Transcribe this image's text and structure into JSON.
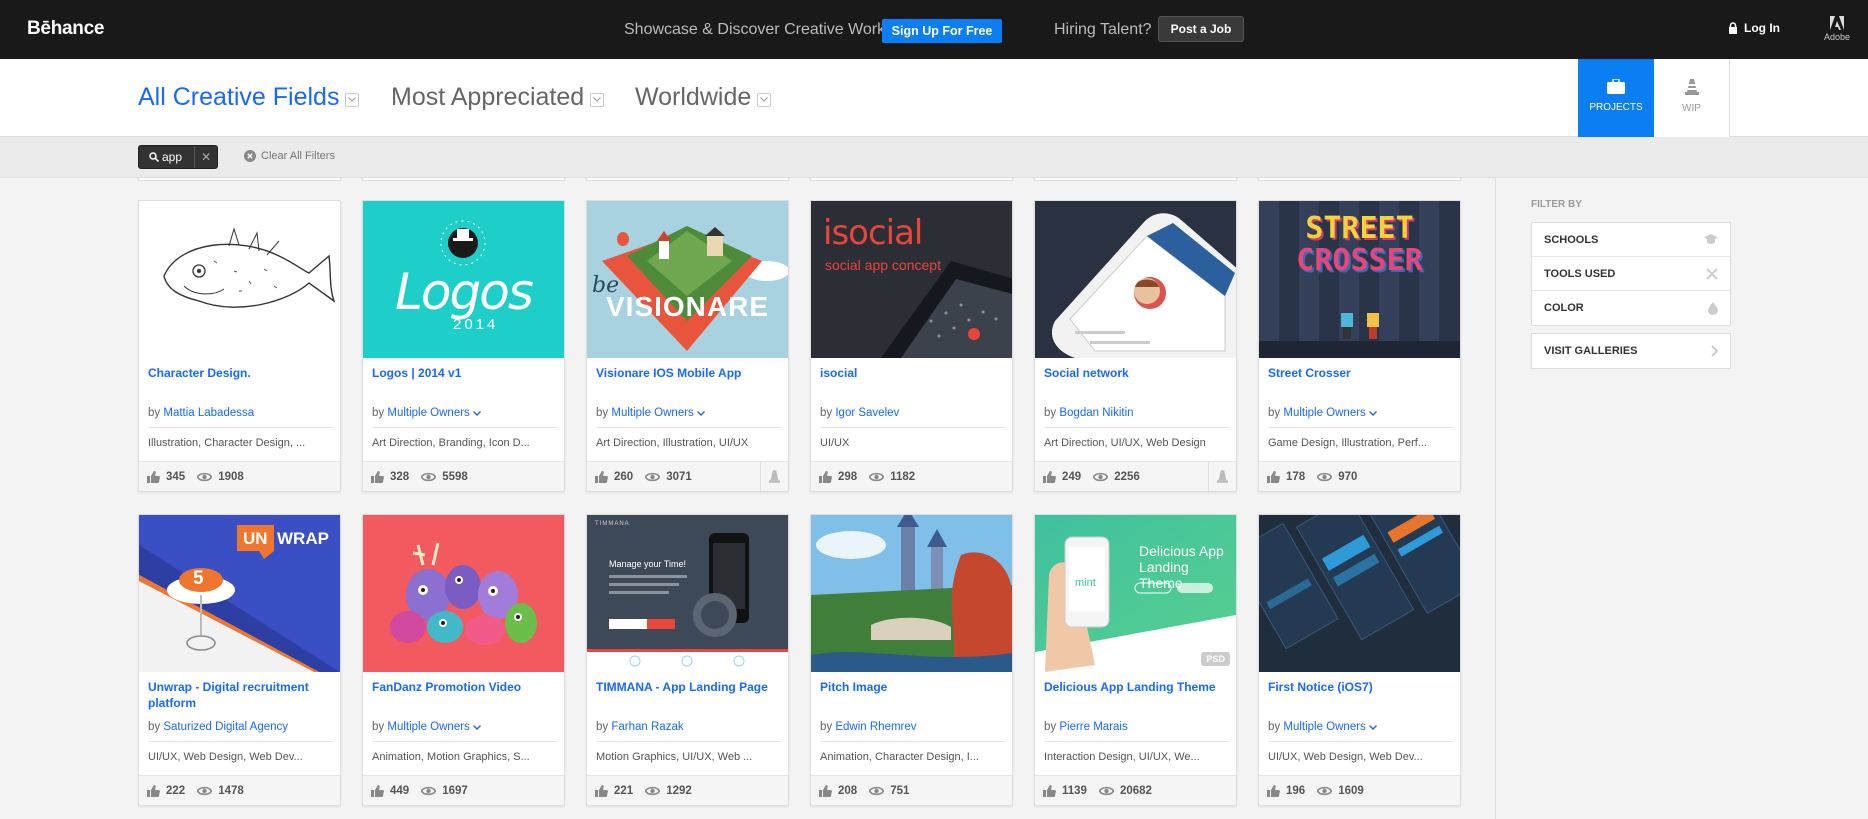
{
  "topbar": {
    "logo": "Bēhance",
    "tagline": "Showcase & Discover Creative Work",
    "signup_label": "Sign Up For Free",
    "hiring_label": "Hiring Talent?",
    "postjob_label": "Post a Job",
    "login_label": "Log In",
    "adobe_label": "Adobe"
  },
  "filters": {
    "field": "All Creative Fields",
    "sort": "Most Appreciated",
    "location": "Worldwide"
  },
  "tabs": {
    "projects": "PROJECTS",
    "wip": "WIP"
  },
  "search": {
    "term": "app",
    "clear_label": "Clear All Filters"
  },
  "sidebar": {
    "heading": "FILTER BY",
    "items": [
      {
        "label": "SCHOOLS",
        "icon": "graduation-cap-icon"
      },
      {
        "label": "TOOLS USED",
        "icon": "tools-icon"
      },
      {
        "label": "COLOR",
        "icon": "drop-icon"
      }
    ],
    "galleries_label": "VISIT GALLERIES"
  },
  "projects": [
    {
      "title": "Character Design.",
      "by": "by",
      "owner": "Mattia Labadessa",
      "multi": false,
      "fields": "Illustration, Character Design, ...",
      "likes": "345",
      "views": "1908",
      "thumb": "fish-sketch"
    },
    {
      "title": "Logos | 2014 v1",
      "by": "by",
      "owner": "Multiple Owners",
      "multi": true,
      "fields": "Art Direction, Branding, Icon D...",
      "likes": "328",
      "views": "5598",
      "thumb_text": "Logos",
      "thumb_sub": "2014"
    },
    {
      "title": "Visionare IOS Mobile App",
      "by": "by",
      "owner": "Multiple Owners",
      "multi": true,
      "fields": "Art Direction, Illustration, UI/UX",
      "likes": "260",
      "views": "3071",
      "wip": true,
      "thumb_text": "VISIONARE",
      "thumb_sub": "be"
    },
    {
      "title": "isocial",
      "by": "by",
      "owner": "Igor Savelev",
      "multi": false,
      "fields": "UI/UX",
      "likes": "298",
      "views": "1182",
      "thumb_text": "isocial",
      "thumb_sub": "social app concept"
    },
    {
      "title": "Social network",
      "by": "by",
      "owner": "Bogdan Nikitin",
      "multi": false,
      "fields": "Art Direction, UI/UX, Web Design",
      "likes": "249",
      "views": "2256",
      "wip": true
    },
    {
      "title": "Street Crosser",
      "by": "by",
      "owner": "Multiple Owners",
      "multi": true,
      "fields": "Game Design, Illustration, Perf...",
      "likes": "178",
      "views": "970",
      "thumb_text": "STREET",
      "thumb_sub": "CROSSER"
    },
    {
      "title": "Unwrap - Digital recruitment platform",
      "by": "by",
      "owner": "Saturized Digital Agency",
      "multi": false,
      "fields": "UI/UX, Web Design, Web Dev...",
      "likes": "222",
      "views": "1478",
      "thumb_text": "UN",
      "thumb_sub": "WRAP",
      "thumb_num": "5"
    },
    {
      "title": "FanDanz Promotion Video",
      "by": "by",
      "owner": "Multiple Owners",
      "multi": true,
      "fields": "Animation, Motion Graphics, S...",
      "likes": "449",
      "views": "1697"
    },
    {
      "title": "TIMMANA - App Landing Page",
      "by": "by",
      "owner": "Farhan Razak",
      "multi": false,
      "fields": "Motion Graphics, UI/UX, Web ...",
      "likes": "221",
      "views": "1292",
      "thumb_text": "Manage your Time!",
      "thumb_sub": "TIMMANA"
    },
    {
      "title": "Pitch Image",
      "by": "by",
      "owner": "Edwin Rhemrev",
      "multi": false,
      "fields": "Animation, Character Design, I...",
      "likes": "208",
      "views": "751"
    },
    {
      "title": "Delicious App Landing Theme",
      "by": "by",
      "owner": "Pierre Marais",
      "multi": false,
      "fields": "Interaction Design, UI/UX, We...",
      "likes": "1139",
      "views": "20682",
      "psd": "PSD",
      "thumb_text": "Delicious App",
      "thumb_sub": "Landing Theme",
      "thumb_brand": "mint"
    },
    {
      "title": "First Notice (iOS7)",
      "by": "by",
      "owner": "Multiple Owners",
      "multi": true,
      "fields": "UI/UX, Web Design, Web Dev...",
      "likes": "196",
      "views": "1609"
    }
  ],
  "colors": {
    "accent": "#1769ff",
    "button_blue": "#0a7ef2",
    "topbar": "#191919"
  }
}
